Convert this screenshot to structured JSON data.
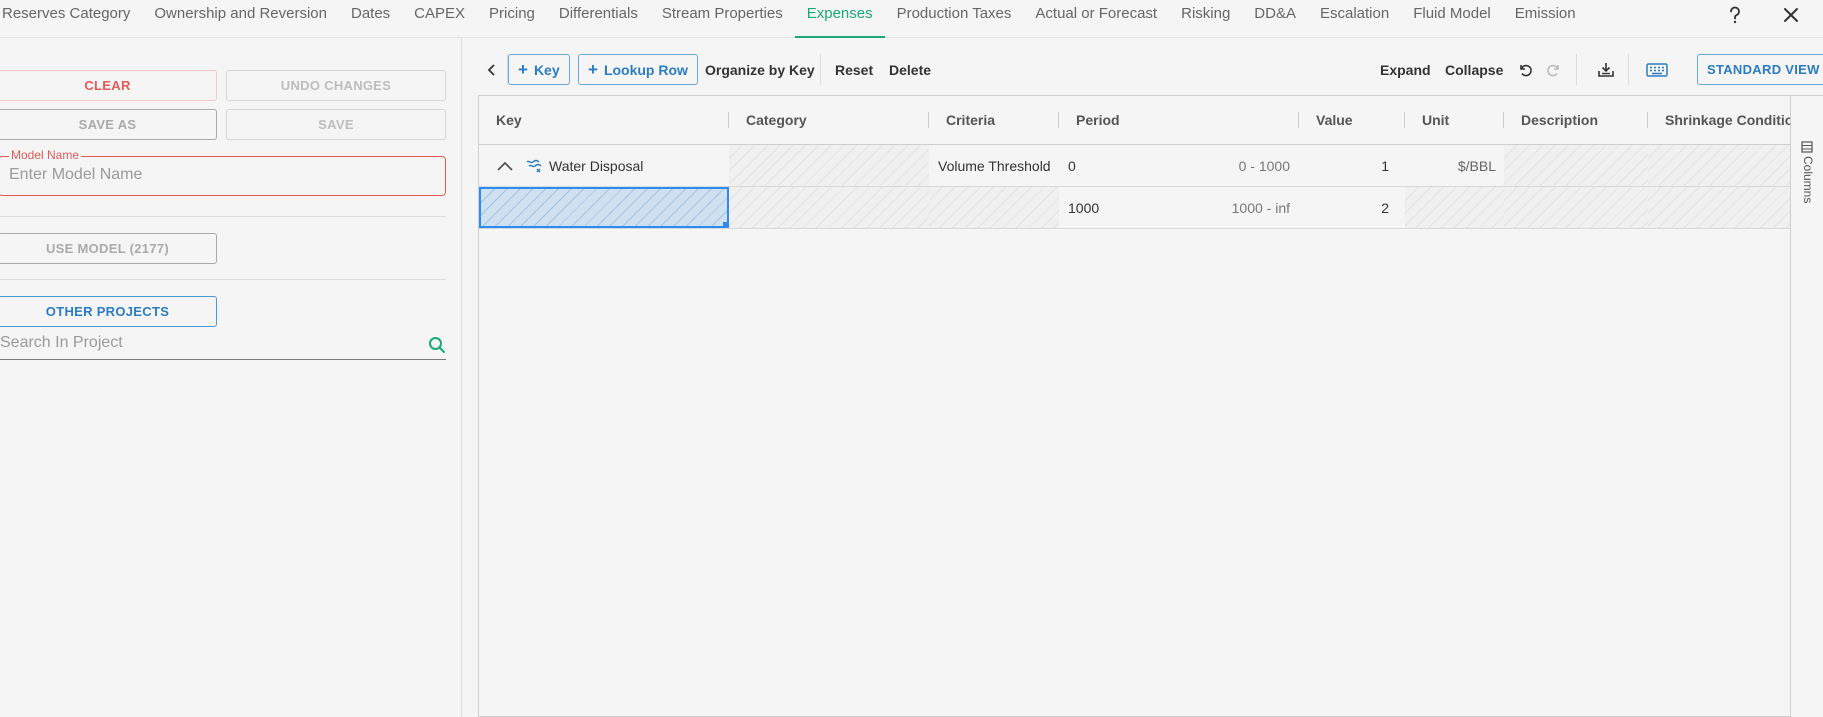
{
  "tabs": [
    {
      "label": "Reserves Category",
      "active": false
    },
    {
      "label": "Ownership and Reversion",
      "active": false
    },
    {
      "label": "Dates",
      "active": false
    },
    {
      "label": "CAPEX",
      "active": false
    },
    {
      "label": "Pricing",
      "active": false
    },
    {
      "label": "Differentials",
      "active": false
    },
    {
      "label": "Stream Properties",
      "active": false
    },
    {
      "label": "Expenses",
      "active": true
    },
    {
      "label": "Production Taxes",
      "active": false
    },
    {
      "label": "Actual or Forecast",
      "active": false
    },
    {
      "label": "Risking",
      "active": false
    },
    {
      "label": "DD&A",
      "active": false
    },
    {
      "label": "Escalation",
      "active": false
    },
    {
      "label": "Fluid Model",
      "active": false
    },
    {
      "label": "Emission",
      "active": false
    }
  ],
  "top_icons": {
    "help": "help-icon",
    "close": "close-icon"
  },
  "colors": {
    "accent": "#19a97b",
    "danger": "#e35a5a",
    "primary": "#2b7cc1",
    "selection": "#2d8cf0"
  },
  "left": {
    "clear_label": "CLEAR",
    "undo_label": "UNDO CHANGES",
    "save_as_label": "SAVE AS",
    "save_label": "SAVE",
    "model_name_label": "Model Name",
    "model_name_placeholder": "Enter Model Name",
    "model_name_value": "",
    "use_model_label": "USE MODEL (2177)",
    "other_projects_label": "OTHER PROJECTS",
    "search_placeholder": "Search In Project"
  },
  "toolbar": {
    "back_icon": "chevron-left-icon",
    "add_key_label": "Key",
    "lookup_row_label": "Lookup Row",
    "organize_label": "Organize by Key",
    "reset_label": "Reset",
    "delete_label": "Delete",
    "expand_label": "Expand",
    "collapse_label": "Collapse",
    "undo_icon": "undo-icon",
    "redo_icon": "redo-icon",
    "import_icon": "import-icon",
    "keyboard_icon": "keyboard-icon",
    "standard_view_label": "STANDARD VIEW"
  },
  "grid": {
    "columns": [
      "Key",
      "Category",
      "Criteria",
      "Period",
      "Value",
      "Unit",
      "Description",
      "Shrinkage Condition"
    ],
    "rows": [
      {
        "key": "Water Disposal",
        "category": "",
        "criteria": "Volume Threshold",
        "period": "0",
        "period_range": "0 - 1000",
        "value": "1",
        "unit": "$/BBL",
        "description": "",
        "shrinkage": ""
      },
      {
        "key": "",
        "category": "",
        "criteria": "",
        "period": "1000",
        "period_range": "1000 - inf",
        "value": "2",
        "unit": "",
        "description": "",
        "shrinkage": ""
      }
    ]
  },
  "columns_panel_label": "Columns"
}
